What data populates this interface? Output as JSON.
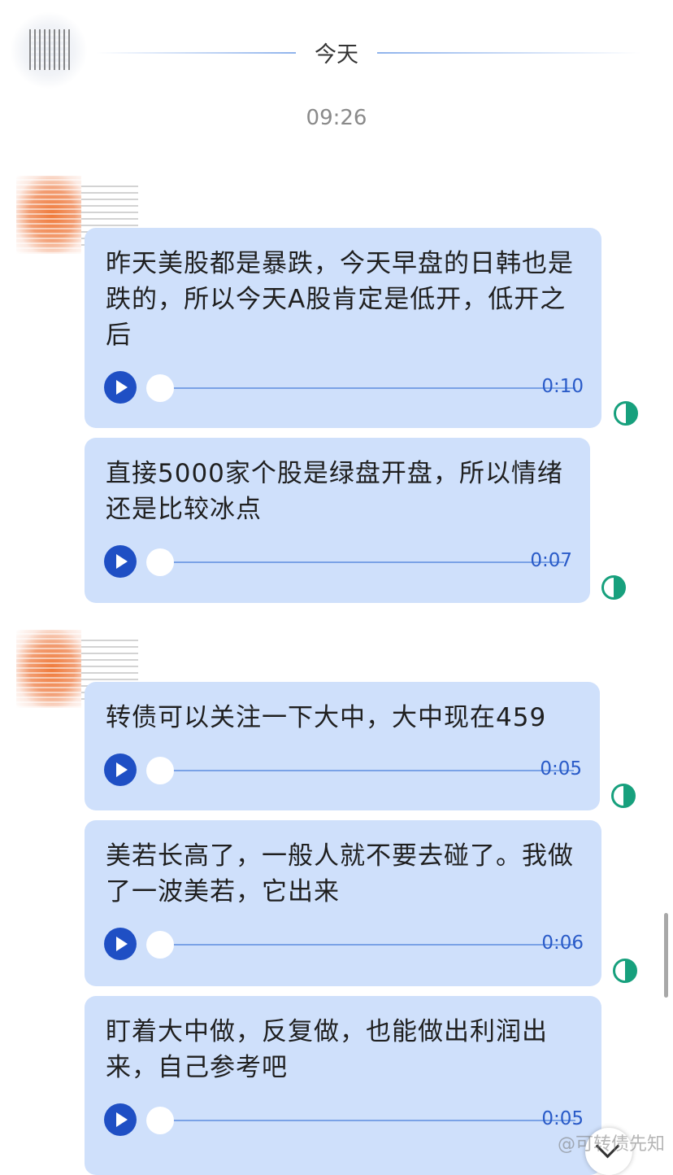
{
  "header": {
    "date_divider": "今天",
    "timestamp": "09:26"
  },
  "messages": [
    {
      "text": "昨天美股都是暴跌，今天早盘的日韩也是跌的，所以今天A股肯定是低开，低开之后",
      "duration": "0:10",
      "status_icon": "partial-circle-icon"
    },
    {
      "text": "直接5000家个股是绿盘开盘，所以情绪还是比较冰点",
      "duration": "0:07",
      "status_icon": "partial-circle-icon"
    },
    {
      "text": "转债可以关注一下大中，大中现在459",
      "duration": "0:05",
      "status_icon": "partial-circle-icon"
    },
    {
      "text": "美若长高了，一般人就不要去碰了。我做了一波美若，它出来",
      "duration": "0:06",
      "status_icon": "partial-circle-icon"
    },
    {
      "text": "盯着大中做，反复做，也能做出利润出来，自己参考吧",
      "duration": "0:05",
      "status_icon": "partial-circle-icon"
    }
  ],
  "watermark": "@可转债先知",
  "colors": {
    "bubble": "#cfe0fb",
    "play_button": "#1f4fc4",
    "status": "#17a07d"
  }
}
